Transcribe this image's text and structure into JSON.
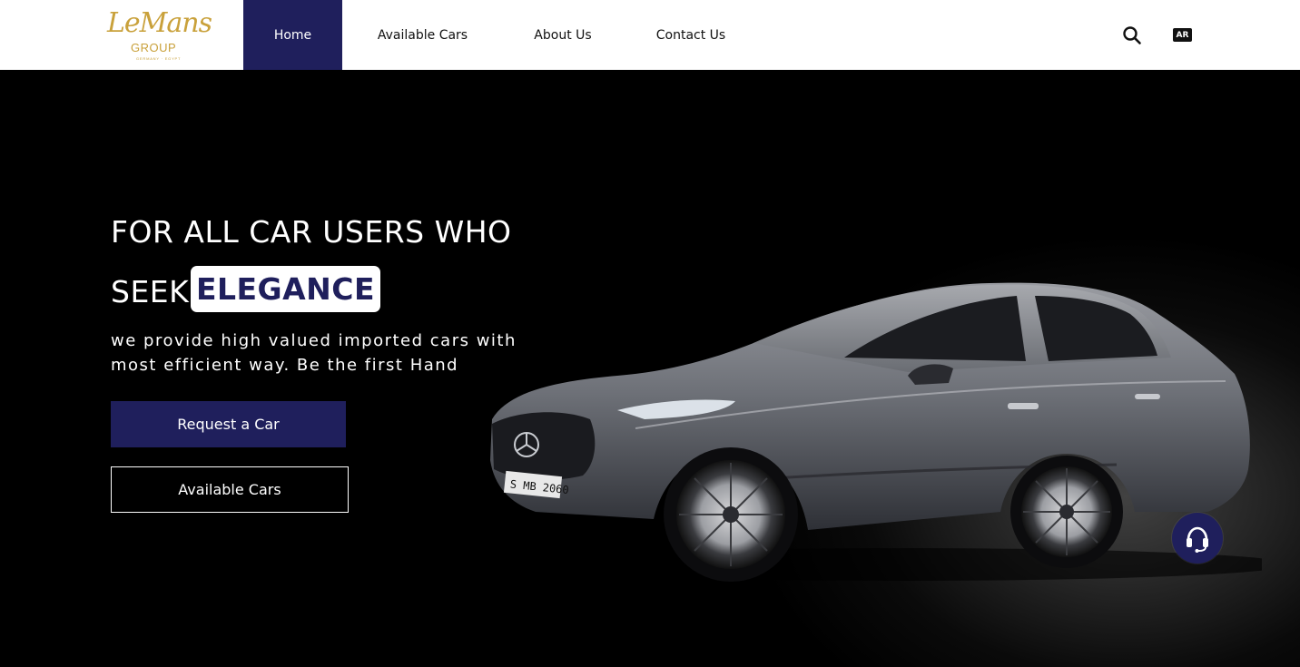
{
  "brand": {
    "logo_script": "LeMans",
    "logo_group": "GROUP",
    "logo_tagline": "GERMANY · EGYPT"
  },
  "nav": {
    "items": [
      {
        "label": "Home",
        "active": true
      },
      {
        "label": "Available Cars",
        "active": false
      },
      {
        "label": "About Us",
        "active": false
      },
      {
        "label": "Contact Us",
        "active": false
      }
    ],
    "search_icon": "search-icon",
    "language_label": "AR"
  },
  "hero": {
    "headline_line1": "FOR ALL CAR USERS WHO",
    "headline_seek": "SEEK",
    "headline_highlight": "ELEGANCE",
    "subtext": "we provide high valued imported cars with most efficient way. Be the first Hand",
    "request_button": "Request a Car",
    "available_button": "Available Cars",
    "car_plate": "S MB 2060",
    "support_icon": "headset-icon"
  },
  "colors": {
    "brand_navy": "#1f1f5c",
    "gold": "#c9a13b",
    "hero_bg": "#000000"
  }
}
